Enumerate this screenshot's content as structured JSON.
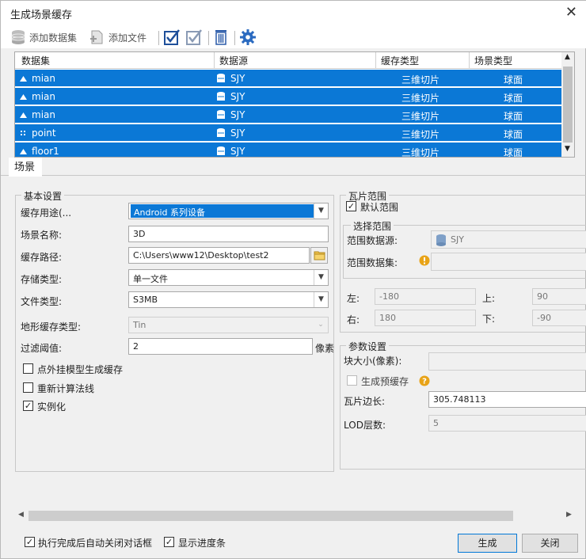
{
  "window": {
    "title": "生成场景缓存",
    "close_glyph": "✕"
  },
  "toolbar": {
    "add_dataset": "添加数据集",
    "add_file": "添加文件"
  },
  "grid": {
    "columns": [
      "数据集",
      "数据源",
      "缓存类型",
      "场景类型"
    ],
    "rows": [
      {
        "dataset": "mian",
        "source": "SJY",
        "cache_type": "三维切片",
        "scene_type": "球面",
        "icon": "region-icon"
      },
      {
        "dataset": "mian",
        "source": "SJY",
        "cache_type": "三维切片",
        "scene_type": "球面",
        "icon": "region-icon"
      },
      {
        "dataset": "mian",
        "source": "SJY",
        "cache_type": "三维切片",
        "scene_type": "球面",
        "icon": "region-icon"
      },
      {
        "dataset": "point",
        "source": "SJY",
        "cache_type": "三维切片",
        "scene_type": "球面",
        "icon": "point-icon"
      },
      {
        "dataset": "floor1",
        "source": "SJY",
        "cache_type": "三维切片",
        "scene_type": "球面",
        "icon": "region-icon"
      }
    ],
    "selection_color": "#0b78d6"
  },
  "tab": {
    "label": "场景"
  },
  "basic": {
    "legend": "基本设置",
    "cache_usage_label": "缓存用途(...",
    "cache_usage_value": "Android 系列设备",
    "scene_name_label": "场景名称:",
    "scene_name_value": "3D",
    "cache_path_label": "缓存路径:",
    "cache_path_value": "C:\\Users\\www12\\Desktop\\test2",
    "storage_type_label": "存储类型:",
    "storage_type_value": "单一文件",
    "file_type_label": "文件类型:",
    "file_type_value": "S3MB",
    "terrain_type_label": "地形缓存类型:",
    "terrain_type_value": "Tin",
    "filter_label": "过滤阈值:",
    "filter_value": "2",
    "filter_unit": "像素",
    "chk_external_model": "点外挂模型生成缓存",
    "chk_recompute_normals": "重新计算法线",
    "chk_instancing": "实例化",
    "chk_instancing_checked": "✓"
  },
  "tile_range": {
    "legend": "瓦片范围",
    "default_range": "默认范围",
    "default_checked": "✓",
    "select_legend": "选择范围",
    "range_source_label": "范围数据源:",
    "range_source_value": "SJY",
    "range_dataset_label": "范围数据集:",
    "left_label": "左:",
    "left_value": "-180",
    "top_label": "上:",
    "top_value": "90",
    "right_label": "右:",
    "right_value": "180",
    "bottom_label": "下:",
    "bottom_value": "-90"
  },
  "params": {
    "legend": "参数设置",
    "block_size_label": "块大小(像素):",
    "gen_precache_label": "生成预缓存",
    "tile_edge_label": "瓦片边长:",
    "tile_edge_value": "305.748113",
    "lod_label": "LOD层数:",
    "lod_value": "5"
  },
  "footer": {
    "auto_close": "执行完成后自动关闭对话框",
    "auto_close_checked": "✓",
    "show_progress": "显示进度条",
    "show_progress_checked": "✓",
    "generate": "生成",
    "close": "关闭"
  }
}
